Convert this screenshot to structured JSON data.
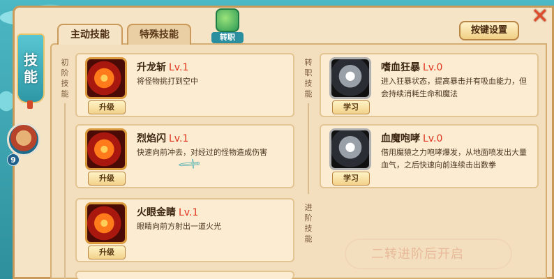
{
  "tabs": {
    "active": "主动技能",
    "inactive": "特殊技能"
  },
  "banner": {
    "line1": "技",
    "line2": "能"
  },
  "avatar": {
    "level": "9"
  },
  "transfer": {
    "label": "转职"
  },
  "keybind_label": "按键设置",
  "close_icon": "close-x-icon",
  "sections": {
    "basic": [
      "初",
      "阶",
      "技",
      "能"
    ],
    "job": [
      "转",
      "职",
      "技",
      "能"
    ],
    "advanced": [
      "进",
      "阶",
      "技",
      "能"
    ]
  },
  "skills_left": [
    {
      "name": "升龙斩",
      "level": "Lv.1",
      "desc": "将怪物挑打到空中",
      "button": "升级",
      "icon": "fire-slash-icon"
    },
    {
      "name": "烈焰闪",
      "level": "Lv.1",
      "desc": "快速向前冲去，对经过的怪物造成伤害",
      "button": "升级",
      "icon": "fireball-icon"
    },
    {
      "name": "火眼金睛",
      "level": "Lv.1",
      "desc": "眼睛向前方射出一道火光",
      "button": "升级",
      "icon": "fire-eyes-icon"
    }
  ],
  "skills_right": [
    {
      "name": "嗜血狂暴",
      "level": "Lv.0",
      "desc": "进入狂暴状态，提高暴击并有吸血能力，但会持续消耗生命和魔法",
      "button": "学习",
      "icon": "berserk-icon"
    },
    {
      "name": "血魔咆哮",
      "level": "Lv.0",
      "desc": "借用魔猿之力咆哮爆发，从地面喷发出大量血气，之后快速向前连续击出数拳",
      "button": "学习",
      "icon": "roar-icon"
    }
  ],
  "locked_text": "二转进阶后开启",
  "colors": {
    "frame_teal": "#3aa6b4",
    "parchment": "#f5e4c6",
    "level_red": "#e0321e"
  }
}
